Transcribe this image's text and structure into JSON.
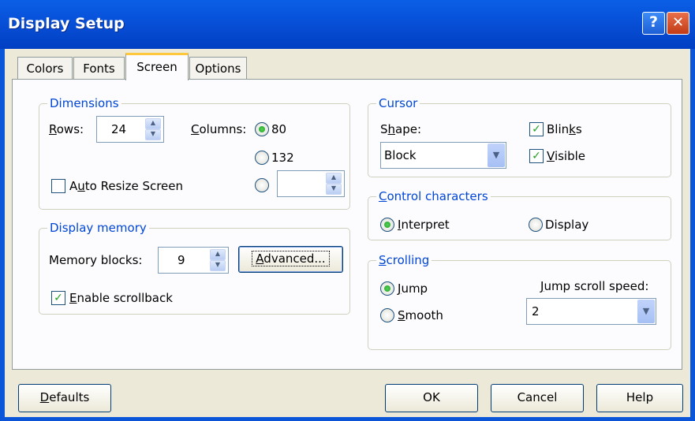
{
  "window": {
    "title": "Display Setup",
    "help_glyph": "?",
    "close_glyph": "✕"
  },
  "tabs": [
    {
      "label": "Colors"
    },
    {
      "label": "Fonts"
    },
    {
      "label": "Screen",
      "active": true
    },
    {
      "label": "Options"
    }
  ],
  "dimensions": {
    "legend": "Dimensions",
    "rows_label_u": "R",
    "rows_label_rest": "ows:",
    "rows_value": "24",
    "columns_label_u": "C",
    "columns_label_rest": "olumns:",
    "col_option_80": "80",
    "col_option_132": "132",
    "col_custom_value": "",
    "col_selected": "80",
    "auto_resize_pre": "A",
    "auto_resize_u": "u",
    "auto_resize_rest": "to Resize Screen",
    "auto_resize_checked": false
  },
  "display_memory": {
    "legend": "Display memory",
    "blocks_label": "Memory blocks:",
    "blocks_value": "9",
    "advanced_u": "A",
    "advanced_rest": "dvanced...",
    "scrollback_u": "E",
    "scrollback_rest": "nable scrollback",
    "scrollback_checked": true
  },
  "cursor": {
    "legend": "Cursor",
    "shape_pre": "S",
    "shape_u": "h",
    "shape_rest": "ape:",
    "shape_value": "Block",
    "blinks_pre": "Blin",
    "blinks_u": "k",
    "blinks_rest": "s",
    "blinks_checked": true,
    "visible_u": "V",
    "visible_rest": "isible",
    "visible_checked": true
  },
  "control_characters": {
    "legend_u": "C",
    "legend_rest": "ontrol characters",
    "interpret_u": "I",
    "interpret_rest": "nterpret",
    "display_label": "Display",
    "selected": "Interpret"
  },
  "scrolling": {
    "legend_u": "S",
    "legend_rest": "crolling",
    "jump_u": "J",
    "jump_rest": "ump",
    "smooth_u": "S",
    "smooth_rest": "mooth",
    "selected": "Jump",
    "speed_label_u": "J",
    "speed_label_rest": "ump scroll speed:",
    "speed_value": "2"
  },
  "footer": {
    "defaults_u": "D",
    "defaults_rest": "efaults",
    "ok": "OK",
    "cancel": "Cancel",
    "help": "Help"
  },
  "colors": {
    "title_bar": "#0a5fe6",
    "dialog_bg": "#ece9d8",
    "panel_bg": "#fcfcfe",
    "legend_text": "#0046d5",
    "check_mark": "#21a121",
    "active_tab_accent": "#ffc83c"
  },
  "icons": [
    "help-icon",
    "close-icon",
    "spin-up-icon",
    "spin-down-icon",
    "dropdown-arrow-icon",
    "check-icon",
    "radio-dot-icon"
  ]
}
